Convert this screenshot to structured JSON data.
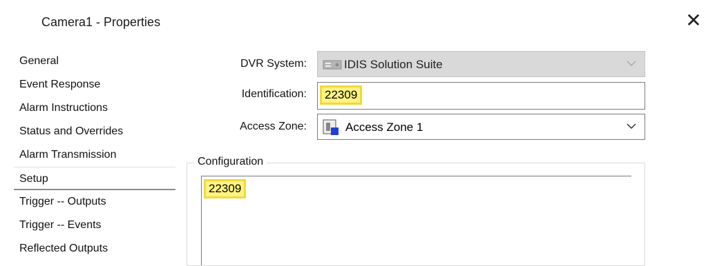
{
  "window": {
    "title": "Camera1 - Properties",
    "close_label": "✕"
  },
  "nav": {
    "items": [
      {
        "label": "General"
      },
      {
        "label": "Event Response"
      },
      {
        "label": "Alarm Instructions"
      },
      {
        "label": "Status and Overrides"
      },
      {
        "label": "Alarm Transmission"
      },
      {
        "label": "Setup",
        "active": true
      },
      {
        "label": "Trigger -- Outputs"
      },
      {
        "label": "Trigger -- Events"
      },
      {
        "label": "Reflected Outputs"
      }
    ]
  },
  "form": {
    "dvr_system": {
      "label": "DVR System:",
      "value": "IDIS Solution Suite",
      "disabled": true,
      "icon": "dvr-server-icon"
    },
    "identification": {
      "label": "Identification:",
      "value": "22309",
      "highlight_color": "#fff480"
    },
    "access_zone": {
      "label": "Access Zone:",
      "value": "Access Zone 1",
      "icon": "access-zone-icon"
    }
  },
  "configuration": {
    "legend": "Configuration",
    "value": "22309"
  }
}
